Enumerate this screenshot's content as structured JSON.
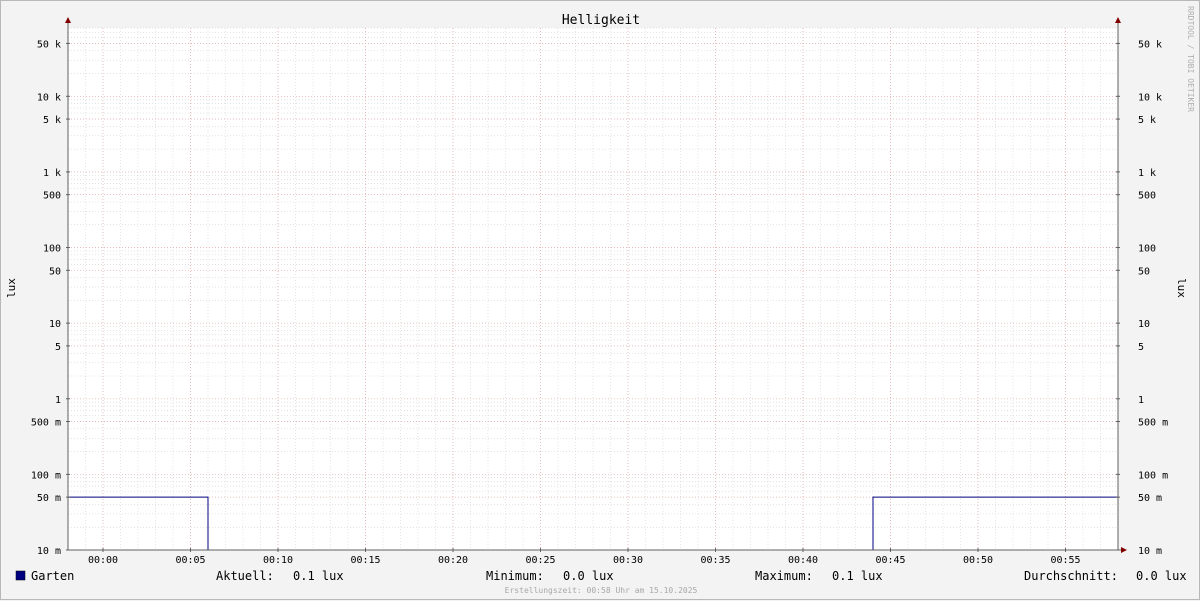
{
  "chart_data": {
    "type": "line",
    "title": "Helligkeit",
    "ylabel": "lux",
    "yscale": "log",
    "ylim": [
      0.01,
      80000
    ],
    "xlim": [
      "23:58",
      "00:58"
    ],
    "x_ticks": [
      "00:00",
      "00:05",
      "00:10",
      "00:15",
      "00:20",
      "00:25",
      "00:30",
      "00:35",
      "00:40",
      "00:45",
      "00:50",
      "00:55"
    ],
    "y_ticks": [
      {
        "value": 50000,
        "label": "50 k"
      },
      {
        "value": 10000,
        "label": "10 k"
      },
      {
        "value": 5000,
        "label": "5 k"
      },
      {
        "value": 1000,
        "label": "1 k"
      },
      {
        "value": 500,
        "label": "500"
      },
      {
        "value": 100,
        "label": "100"
      },
      {
        "value": 50,
        "label": "50"
      },
      {
        "value": 10,
        "label": "10"
      },
      {
        "value": 5,
        "label": "5"
      },
      {
        "value": 1,
        "label": "1"
      },
      {
        "value": 0.5,
        "label": "500 m"
      },
      {
        "value": 0.1,
        "label": "100 m"
      },
      {
        "value": 0.05,
        "label": "50 m"
      },
      {
        "value": 0.01,
        "label": "10 m"
      }
    ],
    "grid": true,
    "colors": {
      "series": "#000080",
      "major_grid": "#e8a3a3",
      "minor_grid": "#c9c9c9",
      "axis": "#606060",
      "arrow": "#800000"
    },
    "series": [
      {
        "name": "Garten",
        "color": "#000080",
        "x": [
          "23:58",
          "00:06",
          "00:06",
          "00:44",
          "00:44",
          "00:58"
        ],
        "values": [
          0.05,
          0.05,
          0.01,
          0.01,
          0.05,
          0.05
        ]
      }
    ]
  },
  "legend": {
    "series_name": "Garten",
    "current_label": "Aktuell:",
    "current_value": "0.1 lux",
    "min_label": "Minimum:",
    "min_value": "0.0 lux",
    "max_label": "Maximum:",
    "max_value": "0.1 lux",
    "avg_label": "Durchschnitt:",
    "avg_value": "0.0 lux"
  },
  "watermark": "RRDTOOL / TOBI OETIKER",
  "footer_note": "Erstellungszeit: 00:58 Uhr am 15.10.2025"
}
